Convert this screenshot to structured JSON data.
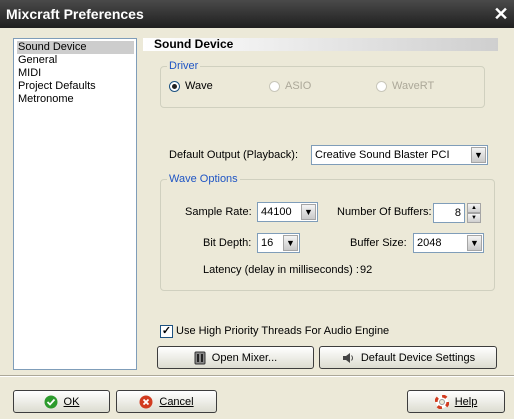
{
  "window": {
    "title": "Mixcraft Preferences"
  },
  "nav": {
    "items": [
      "Sound Device",
      "General",
      "MIDI",
      "Project Defaults",
      "Metronome"
    ],
    "selected": "Sound Device"
  },
  "section": {
    "title": "Sound Device"
  },
  "driver": {
    "legend": "Driver",
    "options": [
      {
        "label": "Wave",
        "selected": true,
        "enabled": true
      },
      {
        "label": "ASIO",
        "selected": false,
        "enabled": false
      },
      {
        "label": "WaveRT",
        "selected": false,
        "enabled": false
      }
    ]
  },
  "output": {
    "label": "Default Output (Playback):",
    "value": "Creative Sound Blaster PCI"
  },
  "wave_options": {
    "legend": "Wave Options",
    "sample_rate": {
      "label": "Sample Rate:",
      "value": "44100"
    },
    "buffers": {
      "label": "Number Of Buffers:",
      "value": "8"
    },
    "bit_depth": {
      "label": "Bit Depth:",
      "value": "16"
    },
    "buffer_size": {
      "label": "Buffer Size:",
      "value": "2048"
    },
    "latency": {
      "label": "Latency (delay in milliseconds) :",
      "value": "92"
    }
  },
  "high_priority": {
    "label": "Use High Priority Threads For Audio Engine",
    "checked": true
  },
  "buttons": {
    "open_mixer": "Open Mixer...",
    "default_settings": "Default Device Settings",
    "ok": "OK",
    "cancel": "Cancel",
    "help": "Help"
  },
  "colors": {
    "legend": "#1f55c4",
    "titlebar": "#2a2a2a",
    "dialog_bg": "#ece9d8"
  }
}
